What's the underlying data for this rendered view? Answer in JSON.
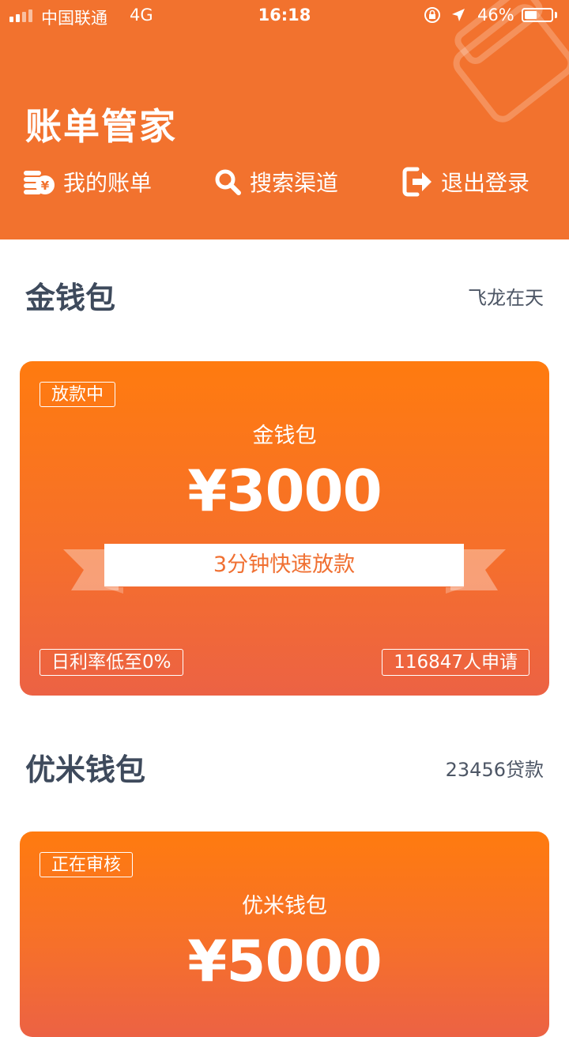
{
  "status_bar": {
    "carrier": "中国联通",
    "network": "4G",
    "time": "16:18",
    "battery_percent": "46%",
    "battery_level": 0.46
  },
  "header": {
    "title": "账单管家",
    "bg_color": "#f2722e",
    "nav": [
      {
        "label": "我的账单",
        "icon": "coins-yen-icon"
      },
      {
        "label": "搜索渠道",
        "icon": "search-icon"
      },
      {
        "label": "退出登录",
        "icon": "logout-icon"
      }
    ]
  },
  "sections": [
    {
      "title": "金钱包",
      "meta": "飞龙在天",
      "card": {
        "badge": "放款中",
        "name": "金钱包",
        "amount": "¥3000",
        "ribbon": "3分钟快速放款",
        "rate": "日利率低至0%",
        "applicants": "116847人申请"
      }
    },
    {
      "title": "优米钱包",
      "meta": "23456贷款",
      "card": {
        "badge": "正在审核",
        "name": "优米钱包",
        "amount": "¥5000"
      }
    }
  ]
}
